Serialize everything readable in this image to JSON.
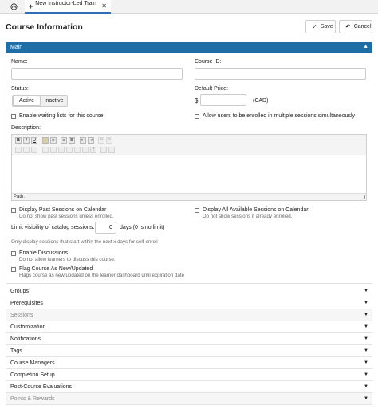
{
  "tabs": {
    "active_label": "New Instructor-Led Train ..."
  },
  "header": {
    "title": "Course Information",
    "save_label": "Save",
    "cancel_label": "Cancel"
  },
  "main": {
    "panel_title": "Main",
    "name_label": "Name:",
    "name_value": "",
    "course_id_label": "Course ID:",
    "course_id_value": "",
    "status_label": "Status:",
    "status_options": [
      "Active",
      "Inactive"
    ],
    "status_selected": "Active",
    "price_label": "Default Price:",
    "currency_symbol": "$",
    "price_value": "",
    "currency_code": "(CAD)",
    "waiting_list_label": "Enable waiting lists for this course",
    "multi_sessions_label": "Allow users to be enrolled in multiple sessions simultaneously",
    "description_label": "Description:",
    "editor_path": "Path:",
    "past_sessions_label": "Display Past Sessions on Calendar",
    "past_sessions_sub": "Do not show past sessions unless enrolled.",
    "all_sessions_label": "Display All Available Sessions on Calendar",
    "all_sessions_sub": "Do not show sessions if already enrolled.",
    "visibility_label": "Limit visibility of catalog sessions:",
    "visibility_value": "0",
    "visibility_suffix": "days (0 is no limit)",
    "visibility_sub": "Only display sessions that start within the next x days for self-enroll",
    "discussions_label": "Enable Discussions",
    "discussions_sub": "Do not allow learners to discuss this course.",
    "flag_label": "Flag Course As New/Updated",
    "flag_sub": "Flags course as new/updated on the learner dashboard until expiration date"
  },
  "sections": [
    {
      "label": "Groups",
      "disabled": false
    },
    {
      "label": "Prerequisites",
      "disabled": false
    },
    {
      "label": "Sessions",
      "disabled": true
    },
    {
      "label": "Customization",
      "disabled": false
    },
    {
      "label": "Notifications",
      "disabled": false
    },
    {
      "label": "Tags",
      "disabled": false
    },
    {
      "label": "Course Managers",
      "disabled": false
    },
    {
      "label": "Completion Setup",
      "disabled": false
    },
    {
      "label": "Post-Course Evaluations",
      "disabled": false
    },
    {
      "label": "Points & Rewards",
      "disabled": true
    }
  ],
  "colors": {
    "accent": "#1f6ea6",
    "tab_underline": "#2f6db5"
  }
}
